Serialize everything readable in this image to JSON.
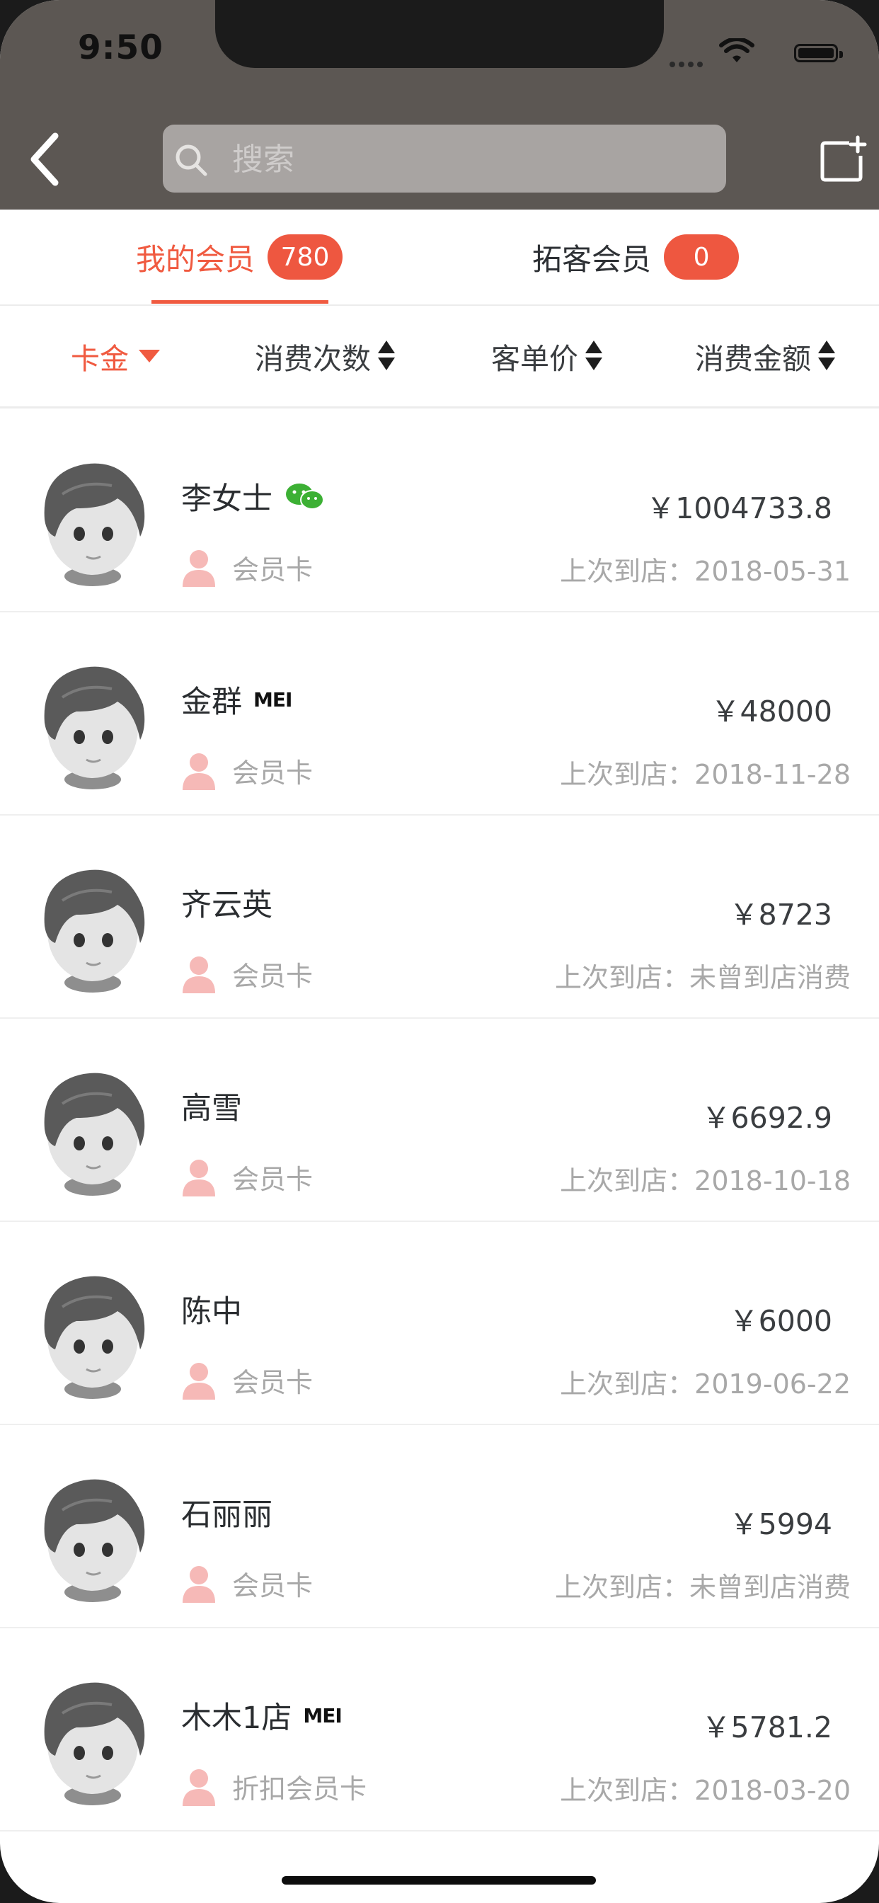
{
  "status_bar": {
    "time": "9:50"
  },
  "header": {
    "search_placeholder": "搜索",
    "back_icon": "chevron-left-icon",
    "new_icon": "new-note-icon"
  },
  "tabs": [
    {
      "label": "我的会员",
      "badge": "780",
      "active": true
    },
    {
      "label": "拓客会员",
      "badge": "0",
      "active": false
    }
  ],
  "sort": {
    "card": "卡金",
    "count": "消费次数",
    "avg": "客单价",
    "amount": "消费金额"
  },
  "colors": {
    "accent": "#f05a40",
    "header_bg": "#5c5753",
    "badge_bg": "#ee5740",
    "wechat_green": "#3cb034"
  },
  "members": [
    {
      "name": "李女士",
      "tag": "",
      "wechat": true,
      "amount": "￥1004733.8",
      "card": "会员卡",
      "last_visit": "上次到店：2018-05-31"
    },
    {
      "name": "金群",
      "tag": "MEI",
      "wechat": false,
      "amount": "￥48000",
      "card": "会员卡",
      "last_visit": "上次到店：2018-11-28"
    },
    {
      "name": "齐云英",
      "tag": "",
      "wechat": false,
      "amount": "￥8723",
      "card": "会员卡",
      "last_visit": "上次到店：未曾到店消费"
    },
    {
      "name": "高雪",
      "tag": "",
      "wechat": false,
      "amount": "￥6692.9",
      "card": "会员卡",
      "last_visit": "上次到店：2018-10-18"
    },
    {
      "name": "陈中",
      "tag": "",
      "wechat": false,
      "amount": "￥6000",
      "card": "会员卡",
      "last_visit": "上次到店：2019-06-22"
    },
    {
      "name": "石丽丽",
      "tag": "",
      "wechat": false,
      "amount": "￥5994",
      "card": "会员卡",
      "last_visit": "上次到店：未曾到店消费"
    },
    {
      "name": "木木1店",
      "tag": "MEI",
      "wechat": false,
      "amount": "￥5781.2",
      "card": "折扣会员卡",
      "last_visit": "上次到店：2018-03-20"
    }
  ]
}
